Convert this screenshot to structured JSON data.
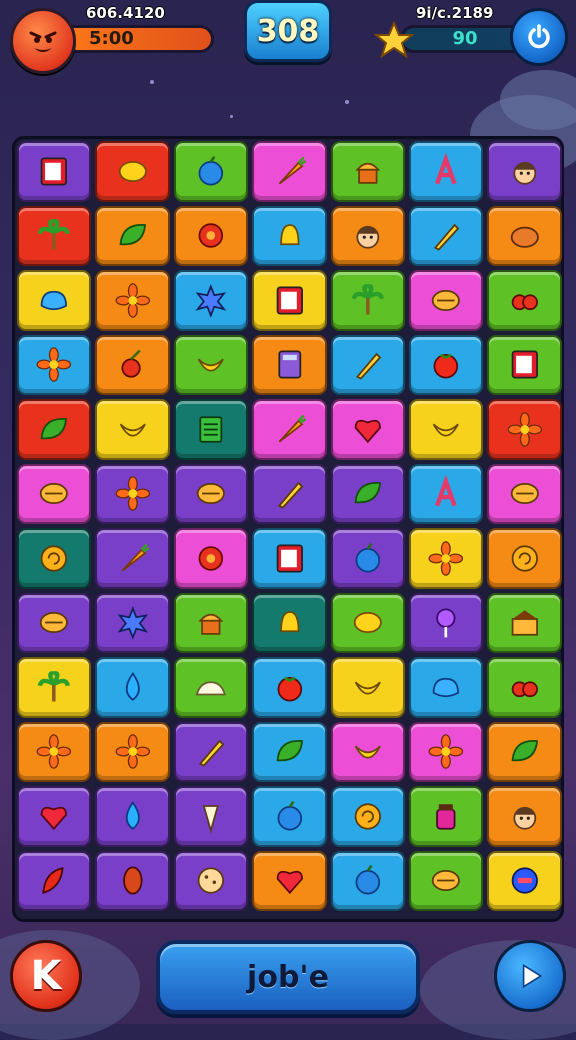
{
  "hud": {
    "left_score": "606.4120",
    "left_timer": "5:00",
    "moves": "308",
    "right_score": "9і/с.2189",
    "right_value": "90"
  },
  "icons": {
    "avatar": "angry-face-icon",
    "star": "star-icon",
    "power": "power-icon",
    "back": "k-letter-icon",
    "play": "play-icon"
  },
  "bottom": {
    "back_label": "K",
    "main_label": "јob'e"
  },
  "board": {
    "rows": [
      [
        "purple:card",
        "red:lemon",
        "green:apple",
        "pink:carrot",
        "green:muffin",
        "blue:letter",
        "purple:boy"
      ],
      [
        "red:palm",
        "orange:leaf",
        "orange:berry",
        "blue:bell",
        "orange:boy",
        "blue:pen",
        "orange:bread"
      ],
      [
        "yellow:blob",
        "orange:flower",
        "blue:splat",
        "yellow:card",
        "green:palm",
        "pink:melon",
        "green:berries"
      ],
      [
        "blue:flower",
        "orange:cherry",
        "green:banana",
        "orange:calc",
        "blue:pen",
        "blue:tomato",
        "green:card"
      ],
      [
        "red:leaf",
        "yellow:banana",
        "teal:note",
        "pink:carrot",
        "pink:heart",
        "yellow:banana",
        "red:flower"
      ],
      [
        "pink:melon",
        "purple:flower",
        "purple:melon",
        "purple:pen",
        "purple:leaf",
        "blue:letter",
        "pink:melon"
      ],
      [
        "teal:swirl",
        "purple:carrot",
        "pink:berry",
        "blue:card",
        "purple:apple",
        "yellow:flower",
        "orange:swirl"
      ],
      [
        "purple:melon",
        "purple:splat",
        "green:muffin",
        "teal:bell",
        "green:lemon",
        "purple:lolly",
        "green:cake"
      ],
      [
        "yellow:palm",
        "blue:drop",
        "green:cream",
        "blue:tomato",
        "yellow:banana",
        "blue:blob",
        "green:berries"
      ],
      [
        "orange:flower",
        "orange:flower",
        "purple:pen",
        "blue:leaf",
        "pink:banana",
        "pink:flower",
        "orange:leaf"
      ],
      [
        "purple:heart",
        "purple:drop",
        "purple:cone",
        "blue:apple",
        "blue:swirl",
        "green:jam",
        "orange:boy"
      ],
      [
        "purple:chili",
        "purple:cocoa",
        "purple:cookie",
        "orange:heart",
        "blue:apple",
        "green:melon",
        "yellow:jar"
      ]
    ]
  },
  "colors": {
    "red": "#e8321e",
    "orange": "#f58a14",
    "yellow": "#f6d21c",
    "green": "#5ec226",
    "blue": "#2ba8e8",
    "purple": "#7a3fc8",
    "pink": "#ec4fd6",
    "teal": "#157a6e"
  }
}
